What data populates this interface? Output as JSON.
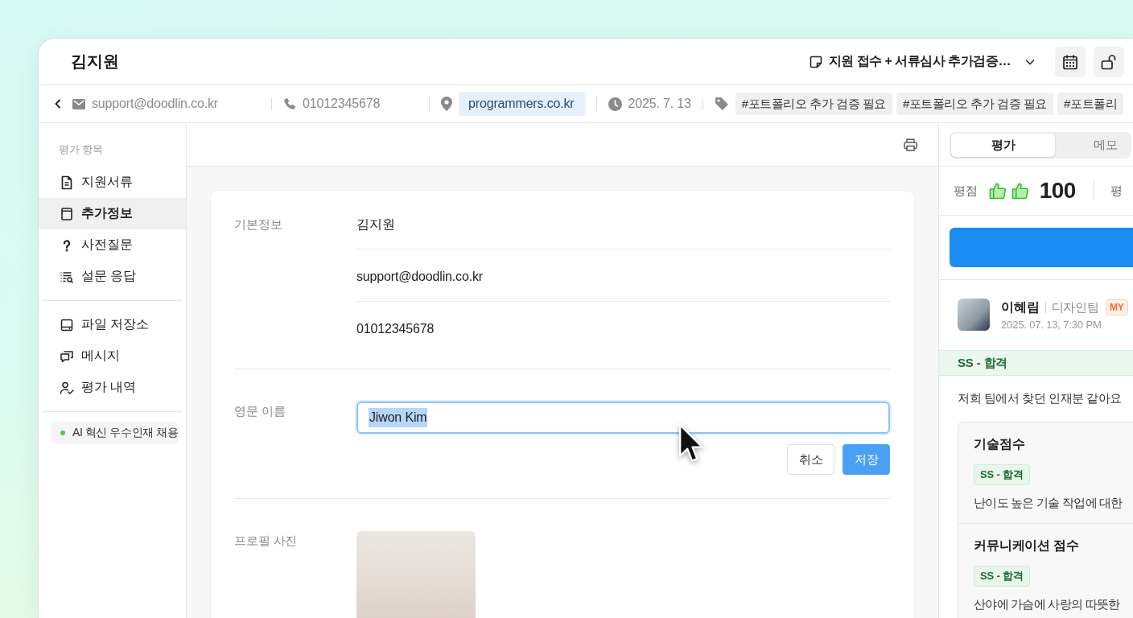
{
  "window": {
    "title": "김지원"
  },
  "header": {
    "stage": "지원 접수 + 서류심사 추가검증…"
  },
  "info_bar": {
    "email": "support@doodlin.co.kr",
    "phone": "01012345678",
    "source": "programmers.co.kr",
    "date": "2025. 7. 13",
    "tags": [
      "#포트폴리오 추가 검증 필요",
      "#포트폴리오 추가 검증 필요",
      "#포트폴리"
    ]
  },
  "sidebar": {
    "heading": "평가 항목",
    "groups": [
      {
        "items": [
          {
            "label": "지원서류",
            "selected": false
          },
          {
            "label": "추가정보",
            "selected": true
          },
          {
            "label": "사전질문",
            "selected": false
          },
          {
            "label": "설문 응답",
            "selected": false
          }
        ]
      },
      {
        "items": [
          {
            "label": "파일 저장소",
            "selected": false
          },
          {
            "label": "메시지",
            "selected": false
          },
          {
            "label": "평가 내역",
            "selected": false
          }
        ]
      }
    ],
    "chip": {
      "label": "AI 혁신 우수인재 채용"
    }
  },
  "content": {
    "sections": [
      {
        "kind": "list",
        "label": "기본정보",
        "values": [
          "김지원",
          "support@doodlin.co.kr",
          "01012345678"
        ]
      },
      {
        "kind": "edit",
        "label": "영문 이름",
        "value": "Jiwon Kim",
        "focused": true,
        "text_selected": true,
        "buttons": [
          {
            "label": "취소",
            "primary": false
          },
          {
            "label": "저장",
            "primary": true
          }
        ]
      },
      {
        "kind": "photo",
        "label": "프로필 사진"
      }
    ]
  },
  "panel": {
    "tabs": [
      {
        "label": "평가",
        "selected": true
      },
      {
        "label": "메모",
        "selected": false
      }
    ],
    "score": {
      "label": "평점",
      "value": "100",
      "next_label": "평"
    },
    "review": {
      "name": "이혜림",
      "team": "디자인팀",
      "badge": "MY",
      "time": "2025. 07. 13, 7:30 PM",
      "result": "SS - 합격",
      "comment": "저희 팀에서 찾던 인재분 같아요",
      "criteria": [
        {
          "title": "기술점수",
          "result": "SS - 합격",
          "text": "난이도 높은 기술 작업에 대한"
        },
        {
          "title": "커뮤니케이션 점수",
          "result": "SS - 합격",
          "text": "산야에 가슴에 사랑의 따뜻한"
        }
      ]
    }
  }
}
